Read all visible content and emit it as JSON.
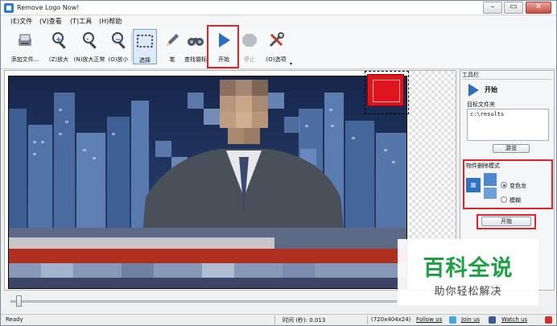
{
  "window": {
    "title": "Remove Logo Now!"
  },
  "menu": [
    "(E)文件",
    "(V)查看",
    "(T)工具",
    "(H)帮助"
  ],
  "toolbar": {
    "add_file": "添加文件...",
    "zoom_in": "(Z)放大",
    "zoom_normal": "(N)放大正常",
    "zoom_out": "(O)放小",
    "select": "选择",
    "pen": "笔",
    "find_logo": "查找徽标",
    "start": "开始",
    "stop": "停止",
    "options": "(O)选项"
  },
  "toolpanel": {
    "title": "工具栏",
    "start_label": "开始",
    "target_folder_label": "目标文件夹",
    "target_folder_value": "c:\\results",
    "browse_button": "游览",
    "removal_mode_label": "物件删除模式",
    "mode_options": [
      "变色龙",
      "模糊"
    ],
    "mode_selected": "变色龙",
    "start_button": "开始"
  },
  "status": {
    "ready": "Ready",
    "time": "时间 (秒): 0.013",
    "resolution": "(720x404x24)",
    "follow": "Follow us",
    "join": "Join us",
    "watch": "Watch us"
  },
  "watermark": {
    "main": "百科全说",
    "sub": "助你轻松解决"
  },
  "colors": {
    "highlight": "#e0242a",
    "accent": "#2d6fb8",
    "watermark_green": "#1f9e44"
  },
  "seek": {
    "position": 0.02
  }
}
